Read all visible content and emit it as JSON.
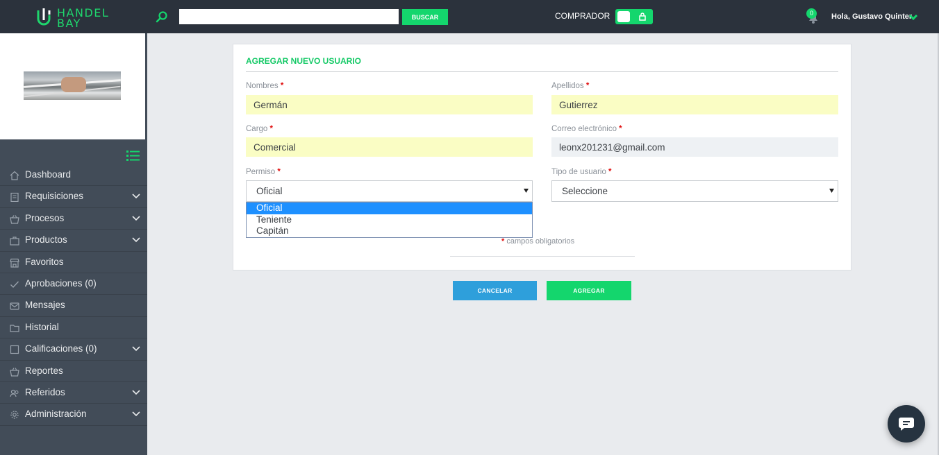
{
  "app": {
    "logo_line1": "HANDEL",
    "logo_line2": "BAY"
  },
  "topbar": {
    "search_placeholder": "",
    "search_button": "BUSCAR",
    "role_label": "COMPRADOR",
    "notification_count": "0",
    "greeting": "Hola, Gustavo Quinter"
  },
  "sidebar": {
    "items": [
      {
        "label": "Dashboard",
        "icon": "home-icon",
        "expandable": false
      },
      {
        "label": "Requisiciones",
        "icon": "clipboard-icon",
        "expandable": true
      },
      {
        "label": "Procesos",
        "icon": "basket-icon",
        "expandable": true
      },
      {
        "label": "Productos",
        "icon": "briefcase-icon",
        "expandable": true
      },
      {
        "label": "Favoritos",
        "icon": "store-icon",
        "expandable": false
      },
      {
        "label": "Aprobaciones (0)",
        "icon": "check-icon",
        "expandable": false
      },
      {
        "label": "Mensajes",
        "icon": "envelope-icon",
        "expandable": false
      },
      {
        "label": "Historial",
        "icon": "folder-icon",
        "expandable": false
      },
      {
        "label": "Calificaciones (0)",
        "icon": "square-icon",
        "expandable": true
      },
      {
        "label": "Reportes",
        "icon": "basket-icon",
        "expandable": false
      },
      {
        "label": "Referidos",
        "icon": "users-icon",
        "expandable": true
      },
      {
        "label": "Administración",
        "icon": "gear-icon",
        "expandable": true
      }
    ]
  },
  "form": {
    "title": "AGREGAR NUEVO USUARIO",
    "nombres_label": "Nombres",
    "nombres_value": "Germán",
    "apellidos_label": "Apellidos",
    "apellidos_value": "Gutierrez",
    "cargo_label": "Cargo",
    "cargo_value": "Comercial",
    "correo_label": "Correo electrónico",
    "correo_value": "leonx201231@gmail.com",
    "permiso_label": "Permiso",
    "permiso_value": "Oficial",
    "permiso_options": [
      "Oficial",
      "Teniente",
      "Capitán"
    ],
    "tipo_label": "Tipo de usuario",
    "tipo_value": "Seleccione",
    "required_star": "*",
    "required_note": "campos obligatorios"
  },
  "actions": {
    "cancel": "CANCELAR",
    "add": "AGREGAR"
  },
  "colors": {
    "accent": "#14d66d",
    "topbar": "#2b323c",
    "sidebar": "#424c58",
    "cancel": "#2e9fdb",
    "highlight": "#1e90ff"
  }
}
